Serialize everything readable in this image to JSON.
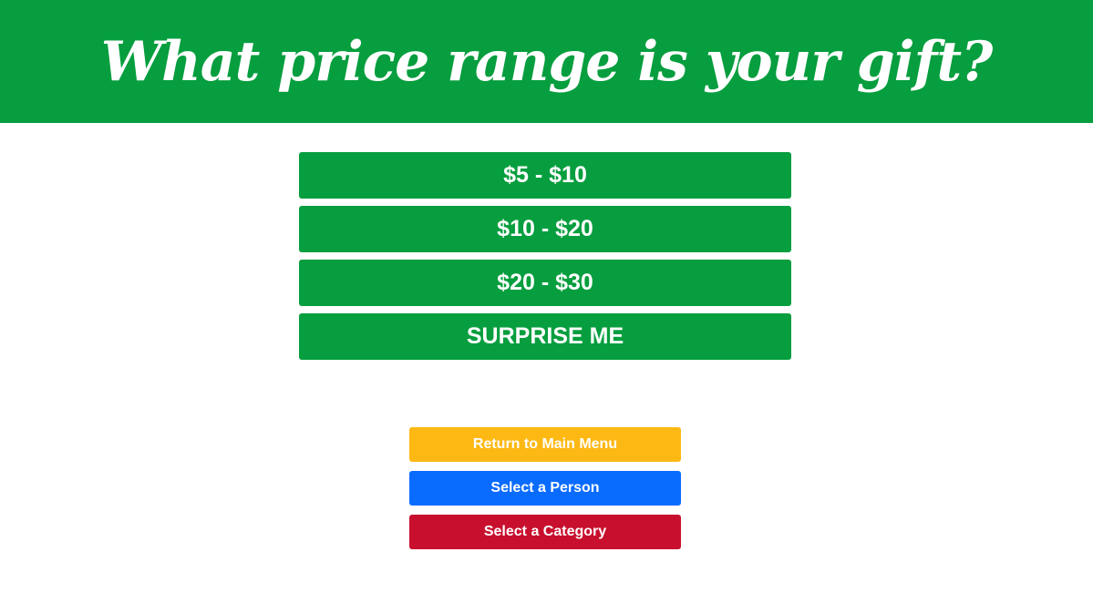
{
  "header": {
    "title": "What price range is your gift?",
    "background_color": "#069e3e"
  },
  "price_options": [
    {
      "label": "$5 - $10"
    },
    {
      "label": "$10 - $20"
    },
    {
      "label": "$20 - $30"
    },
    {
      "label": "SURPRISE ME"
    }
  ],
  "price_button_color": "#069e3e",
  "navigation": {
    "main_menu_label": "Return to Main Menu",
    "main_menu_color": "#fdb813",
    "person_label": "Select a Person",
    "person_color": "#0a6bff",
    "category_label": "Select a Category",
    "category_color": "#c8102e"
  }
}
